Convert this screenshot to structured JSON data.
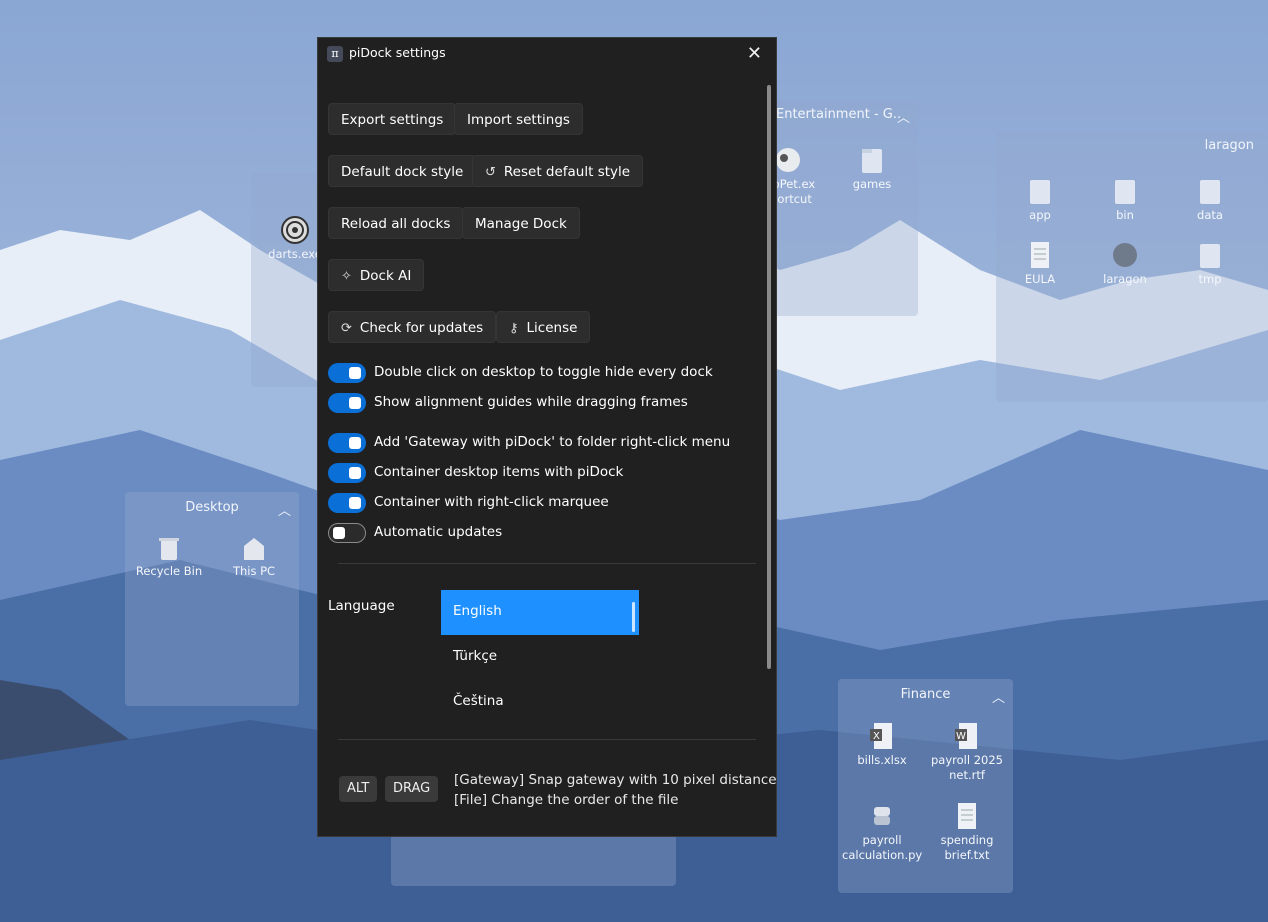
{
  "window": {
    "app_icon_glyph": "π",
    "title": "piDock settings",
    "close_glyph": "✕"
  },
  "buttons": {
    "export": "Export settings",
    "import": "Import settings",
    "default_style": "Default dock style",
    "reset_style": "Reset default style",
    "reload": "Reload all docks",
    "manage": "Manage Dock",
    "dock_ai": "Dock AI",
    "check_updates": "Check for updates",
    "license": "License"
  },
  "toggles": [
    {
      "label": "Double click on desktop to toggle hide every dock",
      "on": true
    },
    {
      "label": "Show alignment guides while dragging frames",
      "on": true
    },
    {
      "label": "Add 'Gateway with piDock' to folder right-click menu",
      "on": true
    },
    {
      "label": "Container desktop items with piDock",
      "on": true
    },
    {
      "label": "Container with right-click marquee",
      "on": true
    },
    {
      "label": "Automatic updates",
      "on": false
    }
  ],
  "language": {
    "label": "Language",
    "options": [
      "English",
      "Türkçe",
      "Čeština"
    ],
    "selected": "English"
  },
  "shortcuts": {
    "keys": [
      "ALT",
      "DRAG"
    ],
    "hints": [
      "[Gateway] Snap gateway with 10 pixel distance",
      "[File] Change the order of the file"
    ]
  },
  "desktop": {
    "frames": {
      "entertainment": {
        "title": "Entertainment - G..",
        "items": [
          "topPet.ex\nshortcut",
          "games"
        ]
      },
      "laragon": {
        "title": "laragon",
        "items": [
          "app",
          "bin",
          "data",
          "EULA",
          "laragon",
          "tmp"
        ]
      },
      "darts": {
        "items": [
          "darts.exe"
        ]
      },
      "desktop": {
        "title": "Desktop",
        "items": [
          "Recycle Bin",
          "This PC"
        ]
      },
      "finance": {
        "title": "Finance",
        "items": [
          "bills.xlsx",
          "payroll 2025\nnet.rtf",
          "payroll\ncalculation.py",
          "spending\nbrief.txt"
        ]
      }
    }
  },
  "colors": {
    "accent": "#0a6fd6",
    "selected_language": "#1e90ff",
    "window_bg": "#202020"
  }
}
